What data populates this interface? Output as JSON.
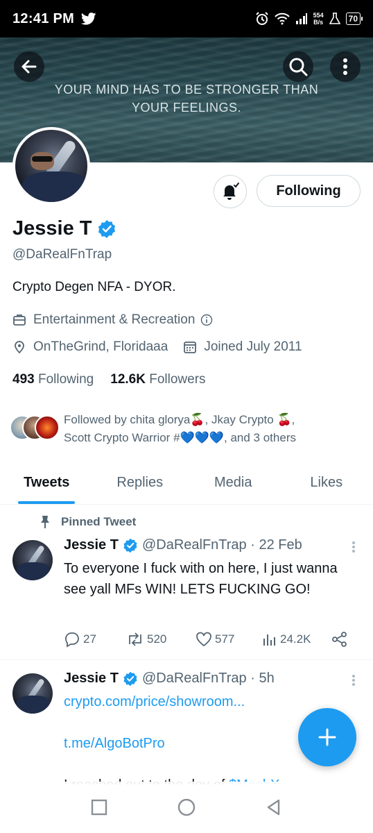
{
  "status_bar": {
    "time": "12:41 PM",
    "net_speed_value": "554",
    "net_speed_unit": "B/s",
    "battery": "70"
  },
  "banner": {
    "text_line1": "YOUR MIND HAS TO BE STRONGER THAN",
    "text_line2": "YOUR FEELINGS."
  },
  "profile": {
    "name": "Jessie T",
    "handle": "@DaRealFnTrap",
    "bio": "Crypto Degen NFA - DYOR.",
    "category": "Entertainment & Recreation",
    "location": "OnTheGrind, Floridaaa",
    "joined": "Joined July 2011",
    "following_count": "493",
    "following_label": "Following",
    "followers_count": "12.6K",
    "followers_label": "Followers",
    "followed_by_line1": "Followed by chita glorya🍒, Jkay Crypto 🍒,",
    "followed_by_line2": "Scott Crypto Warrior #💙💙💙, and 3 others"
  },
  "actions": {
    "following_button": "Following"
  },
  "tabs": [
    {
      "label": "Tweets",
      "active": true
    },
    {
      "label": "Replies",
      "active": false
    },
    {
      "label": "Media",
      "active": false
    },
    {
      "label": "Likes",
      "active": false
    }
  ],
  "tweets": [
    {
      "pinned_label": "Pinned Tweet",
      "name": "Jessie T",
      "handle_time": "@DaRealFnTrap · 22 Feb",
      "text": "To everyone I fuck with on here, I just wanna see yall MFs WIN! LETS FUCKING GO!",
      "replies": "27",
      "retweets": "520",
      "likes": "577",
      "views": "24.2K"
    },
    {
      "name": "Jessie T",
      "handle_time": "@DaRealFnTrap · 5h",
      "link1": "crypto.com/price/showroom...",
      "link2": "t.me/AlgoBotPro",
      "text_partial_before": "I reached out to the dev of ",
      "text_partial_link": "$MechX"
    }
  ],
  "colors": {
    "accent": "#1d9bf0",
    "text_primary": "#0f1419",
    "text_secondary": "#536471"
  }
}
